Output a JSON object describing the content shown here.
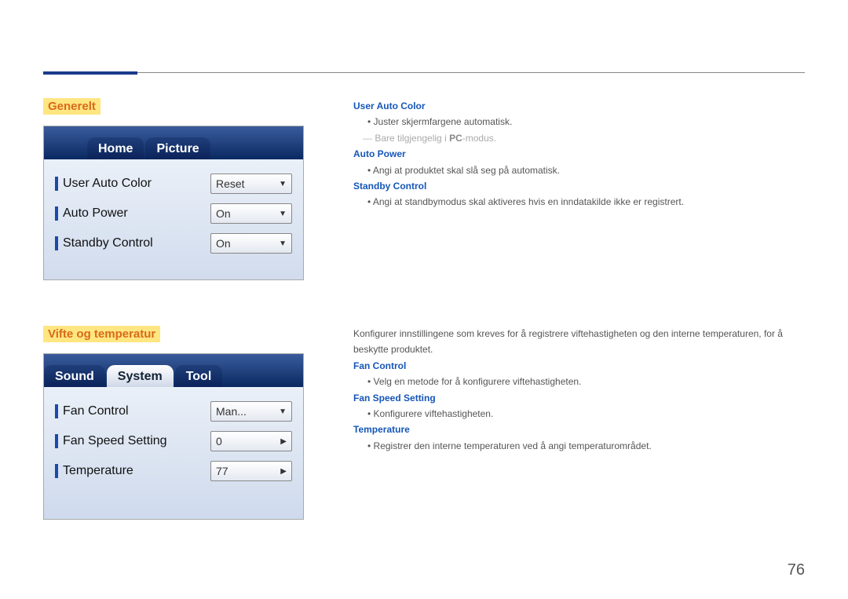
{
  "page_number": "76",
  "section1": {
    "title": "Generelt",
    "tabs": {
      "home": "Home",
      "picture": "Picture"
    },
    "rows": {
      "user_auto_color": {
        "label": "User Auto Color",
        "value": "Reset"
      },
      "auto_power": {
        "label": "Auto Power",
        "value": "On"
      },
      "standby_control": {
        "label": "Standby Control",
        "value": "On"
      }
    },
    "right": {
      "user_auto_color_h": "User Auto Color",
      "user_auto_color_b": "Juster skjermfargene automatisk.",
      "pc_note_pre": "Bare tilgjengelig i ",
      "pc_note_bold": "PC",
      "pc_note_post": "-modus.",
      "auto_power_h": "Auto Power",
      "auto_power_b": "Angi at produktet skal slå seg på automatisk.",
      "standby_control_h": "Standby Control",
      "standby_control_b": "Angi at standbymodus skal aktiveres hvis en inndatakilde ikke er registrert."
    }
  },
  "section2": {
    "title": "Vifte og temperatur",
    "tabs": {
      "sound": "Sound",
      "system": "System",
      "tool": "Tool"
    },
    "rows": {
      "fan_control": {
        "label": "Fan Control",
        "value": "Man..."
      },
      "fan_speed": {
        "label": "Fan Speed Setting",
        "value": "0"
      },
      "temperature": {
        "label": "Temperature",
        "value": "77"
      }
    },
    "right": {
      "intro": "Konfigurer innstillingene som kreves for å registrere viftehastigheten og den interne temperaturen, for å beskytte produktet.",
      "fan_control_h": "Fan Control",
      "fan_control_b": "Velg en metode for å konfigurere viftehastigheten.",
      "fan_speed_h": "Fan Speed Setting",
      "fan_speed_b": "Konfigurere viftehastigheten.",
      "temperature_h": "Temperature",
      "temperature_b": "Registrer den interne temperaturen ved å angi temperaturområdet."
    }
  }
}
